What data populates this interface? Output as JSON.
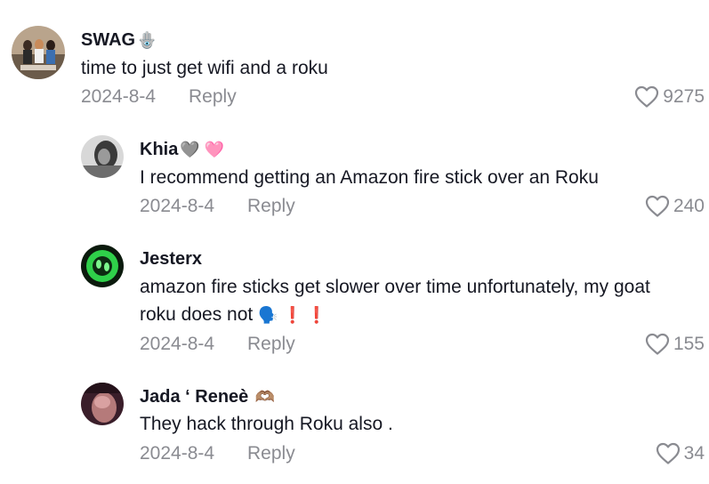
{
  "comments": [
    {
      "username": "SWAG",
      "username_emoji": "🪬",
      "text": "time to just get wifi and a roku",
      "date": "2024-8-4",
      "reply_label": "Reply",
      "likes": "9275"
    },
    {
      "username": "Khia",
      "username_emoji": "🩶 🩷",
      "text": "I recommend getting an Amazon fire stick over an Roku",
      "date": "2024-8-4",
      "reply_label": "Reply",
      "likes": "240"
    },
    {
      "username": "Jesterx",
      "text": "amazon fire sticks get slower over time unfortunately, my goat",
      "text_line2": "roku does not",
      "text_line2_emoji": "🗣️ ❗ ❗",
      "date": "2024-8-4",
      "reply_label": "Reply",
      "likes": "155"
    },
    {
      "username": "Jada ‘ Reneè",
      "username_emoji": "🫶🏽",
      "text": "They hack through Roku also .",
      "date": "2024-8-4",
      "reply_label": "Reply",
      "likes": "34"
    }
  ],
  "colors": {
    "text": "#161823",
    "muted": "#8a8b91",
    "background": "#ffffff"
  },
  "icons": {
    "like": "heart-outline-icon"
  }
}
